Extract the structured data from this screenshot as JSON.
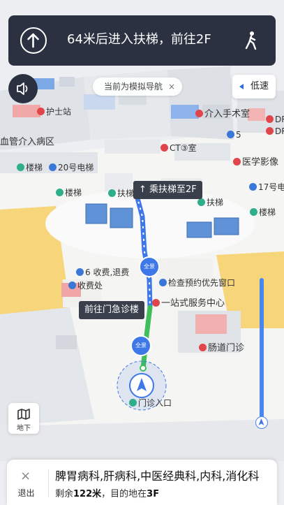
{
  "nav": {
    "instruction": "64米后进入扶梯，前往2F",
    "simulation_label": "当前为模拟导航",
    "simulation_close": "×",
    "speed_label": "低速",
    "escalator_callout": "乘扶梯至2F",
    "route_callout": "前往门急诊楼",
    "floor_button_label": "地下",
    "progress_percent": 100
  },
  "map_labels": {
    "nurse_station": "护士站",
    "interventional_ward": "血管介入病区",
    "interventional_or": "介入手术室",
    "stairs_left": "楼梯",
    "elevator_20": "20号电梯",
    "ct_room": "CT③室",
    "escalator_left": "扶梯",
    "escalator_right": "扶梯",
    "medical_imaging": "医学影像",
    "elevator_17": "17号电",
    "stairs_right": "楼梯",
    "stairs_mid": "楼梯",
    "payment_6": "6 收费,退费",
    "payment_office": "收费处",
    "check_appointment": "检查预约优先窗口",
    "one_stop_service": "一站式服务中心",
    "gi_clinic": "肠道门诊",
    "outpatient_entrance": "门诊入口",
    "num_5": "5",
    "dr_1": "DR",
    "dr_2": "DR",
    "panorama_1": "全景",
    "panorama_2": "全景"
  },
  "bottom": {
    "exit_label": "退出",
    "exit_icon": "×",
    "destination": "脾胃病科,肝病科,中医经典科,内科,消化科",
    "remaining_prefix": "剩余",
    "remaining_distance": "122米",
    "remaining_sep": "，目的地在",
    "floor": "3F"
  },
  "colors": {
    "route": "#3d77e8",
    "route_green": "#3fbf5a",
    "dark_panel": "#2b3140",
    "poi_red": "#e0454b",
    "poi_blue": "#3a78d8",
    "poi_green": "#2fae8a"
  }
}
